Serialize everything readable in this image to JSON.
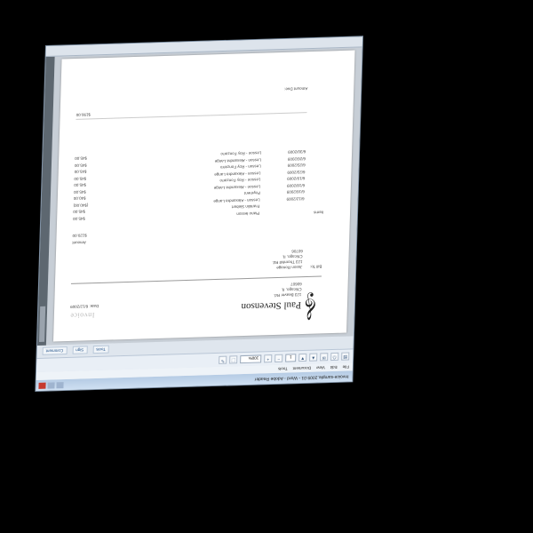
{
  "window": {
    "title": "Invoice-sample.2009.01 - Word - Adobe Reader",
    "menu": [
      "File",
      "Edit",
      "View",
      "Document",
      "Tools"
    ],
    "zoom": "100%",
    "page_number": "1",
    "right_tabs": [
      "Tools",
      "Sign",
      "Comment"
    ]
  },
  "invoice": {
    "sender_name": "Paul Stevenson",
    "sender_address": [
      "123 Beaver Rd.",
      "Chicago, IL",
      "60607"
    ],
    "title": "Invoice",
    "date": "Date: 6/12/2009",
    "bill_to_label": "Bill To:",
    "bill_to": [
      "Jason Ronage",
      "123 Thornhill Rd.",
      "Chicago, IL",
      "60706"
    ],
    "amount_due_label": "Amount",
    "amount_due": "$120.00",
    "items_label": "Items",
    "items": [
      {
        "date": "",
        "desc": "Piano lesson",
        "amount": "$45.00"
      },
      {
        "date": "",
        "desc": "Franklin Siebert",
        "amount": "$45.00"
      },
      {
        "date": "6/12/2009",
        "desc": "Lesson - Alexandra Lange",
        "amount": "($40.00)"
      },
      {
        "date": "6/16/2009",
        "desc": "Payment",
        "amount": "$40.00"
      },
      {
        "date": "6/18/2009",
        "desc": "Lesson - Alexandra Lange",
        "amount": "$45.00"
      },
      {
        "date": "6/19/2009",
        "desc": "Lesson - Roy Fonzarro",
        "amount": "$45.00"
      },
      {
        "date": "6/23/2009",
        "desc": "Lesson - Alexandra Lange",
        "amount": "$45.00"
      },
      {
        "date": "6/25/2009",
        "desc": "Lesson - Roy Fonzarro",
        "amount": "$45.00"
      },
      {
        "date": "6/26/2009",
        "desc": "Lesson - Alexandra Lange",
        "amount": "$45.00"
      },
      {
        "date": "6/30/2009",
        "desc": "Lesson - Roy Fonzarro",
        "amount": "$45.00"
      }
    ],
    "total": "$190.00",
    "footer": "Amount Due:"
  }
}
